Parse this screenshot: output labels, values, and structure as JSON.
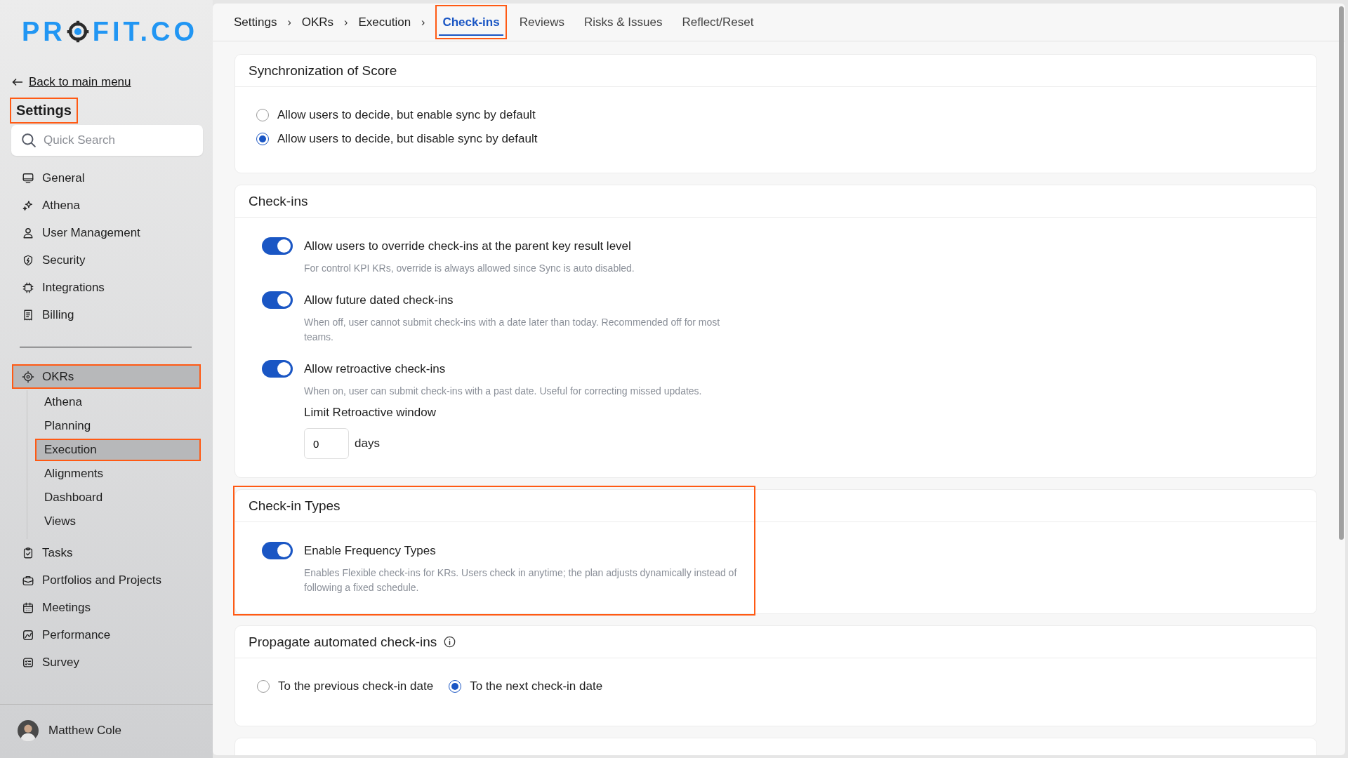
{
  "sidebar": {
    "logo": {
      "left": "PR",
      "right": "FIT.CO"
    },
    "back_link": "Back to main menu",
    "title": {
      "text": "Settings",
      "highlighted": true
    },
    "search": {
      "placeholder": "Quick Search"
    },
    "sections": [
      {
        "items": [
          {
            "label": "General",
            "selected": false,
            "highlighted": false
          },
          {
            "label": "Athena",
            "selected": false,
            "highlighted": false
          },
          {
            "label": "User Management",
            "selected": false,
            "highlighted": false
          },
          {
            "label": "Security",
            "selected": false,
            "highlighted": false
          },
          {
            "label": "Integrations",
            "selected": false,
            "highlighted": false
          },
          {
            "label": "Billing",
            "selected": false,
            "highlighted": false
          }
        ]
      },
      {
        "items": [
          {
            "label": "OKRs",
            "selected": true,
            "highlighted": true,
            "children": [
              {
                "label": "Athena",
                "selected": false,
                "highlighted": false
              },
              {
                "label": "Planning",
                "selected": false,
                "highlighted": false
              },
              {
                "label": "Execution",
                "selected": true,
                "highlighted": true
              },
              {
                "label": "Alignments",
                "selected": false,
                "highlighted": false
              },
              {
                "label": "Dashboard",
                "selected": false,
                "highlighted": false
              },
              {
                "label": "Views",
                "selected": false,
                "highlighted": false
              }
            ]
          },
          {
            "label": "Tasks",
            "selected": false,
            "highlighted": false
          },
          {
            "label": "Portfolios and Projects",
            "selected": false,
            "highlighted": false
          },
          {
            "label": "Meetings",
            "selected": false,
            "highlighted": false
          },
          {
            "label": "Performance",
            "selected": false,
            "highlighted": false
          },
          {
            "label": "Survey",
            "selected": false,
            "highlighted": false
          }
        ]
      }
    ],
    "user": {
      "name": "Matthew Cole"
    }
  },
  "breadcrumb": [
    {
      "label": "Settings",
      "separator": "›"
    },
    {
      "label": "OKRs",
      "separator": "›"
    },
    {
      "label": "Execution",
      "separator": "›"
    }
  ],
  "tabs": [
    {
      "label": "Check-ins",
      "selected": true,
      "highlighted": true
    },
    {
      "label": "Reviews",
      "selected": false,
      "highlighted": false
    },
    {
      "label": "Risks & Issues",
      "selected": false,
      "highlighted": false
    },
    {
      "label": "Reflect/Reset",
      "selected": false,
      "highlighted": false
    }
  ],
  "sections": [
    {
      "kind": "radios",
      "title": "Synchronization of Score",
      "info": false,
      "highlighted": false,
      "options": [
        {
          "label": "Allow users to decide, but enable sync by default",
          "selected": false
        },
        {
          "label": "Allow users to decide, but disable sync by default",
          "selected": true
        }
      ]
    },
    {
      "kind": "toggles",
      "title": "Check-ins",
      "info": false,
      "highlighted": false,
      "toggles": [
        {
          "label": "Allow users to override check-ins at the parent key result level",
          "on": true,
          "description": "For control KPI KRs, override is always allowed since Sync is auto disabled."
        },
        {
          "label": "Allow future dated check-ins",
          "on": true,
          "description": "When off, user cannot submit check-ins with a date later than today. Recommended off for most teams."
        },
        {
          "label": "Allow retroactive check-ins",
          "on": true,
          "description": "When on, user can submit check-ins with a past date. Useful for correcting missed updates.",
          "limit": {
            "label": "Limit Retroactive window",
            "value": "0",
            "unit": "days"
          }
        }
      ]
    },
    {
      "kind": "toggles",
      "title": "Check-in Types",
      "info": false,
      "highlighted": true,
      "toggles": [
        {
          "label": "Enable Frequency Types",
          "on": true,
          "description": "Enables Flexible check-ins for KRs. Users check in anytime; the plan adjusts dynamically instead of following a fixed schedule."
        }
      ]
    },
    {
      "kind": "radios_inline",
      "title": "Propagate automated check-ins",
      "info": true,
      "highlighted": false,
      "options": [
        {
          "label": "To the previous check-in date",
          "selected": false
        },
        {
          "label": "To the next check-in date",
          "selected": true
        }
      ]
    },
    {
      "kind": "empty",
      "highlighted": false
    }
  ]
}
